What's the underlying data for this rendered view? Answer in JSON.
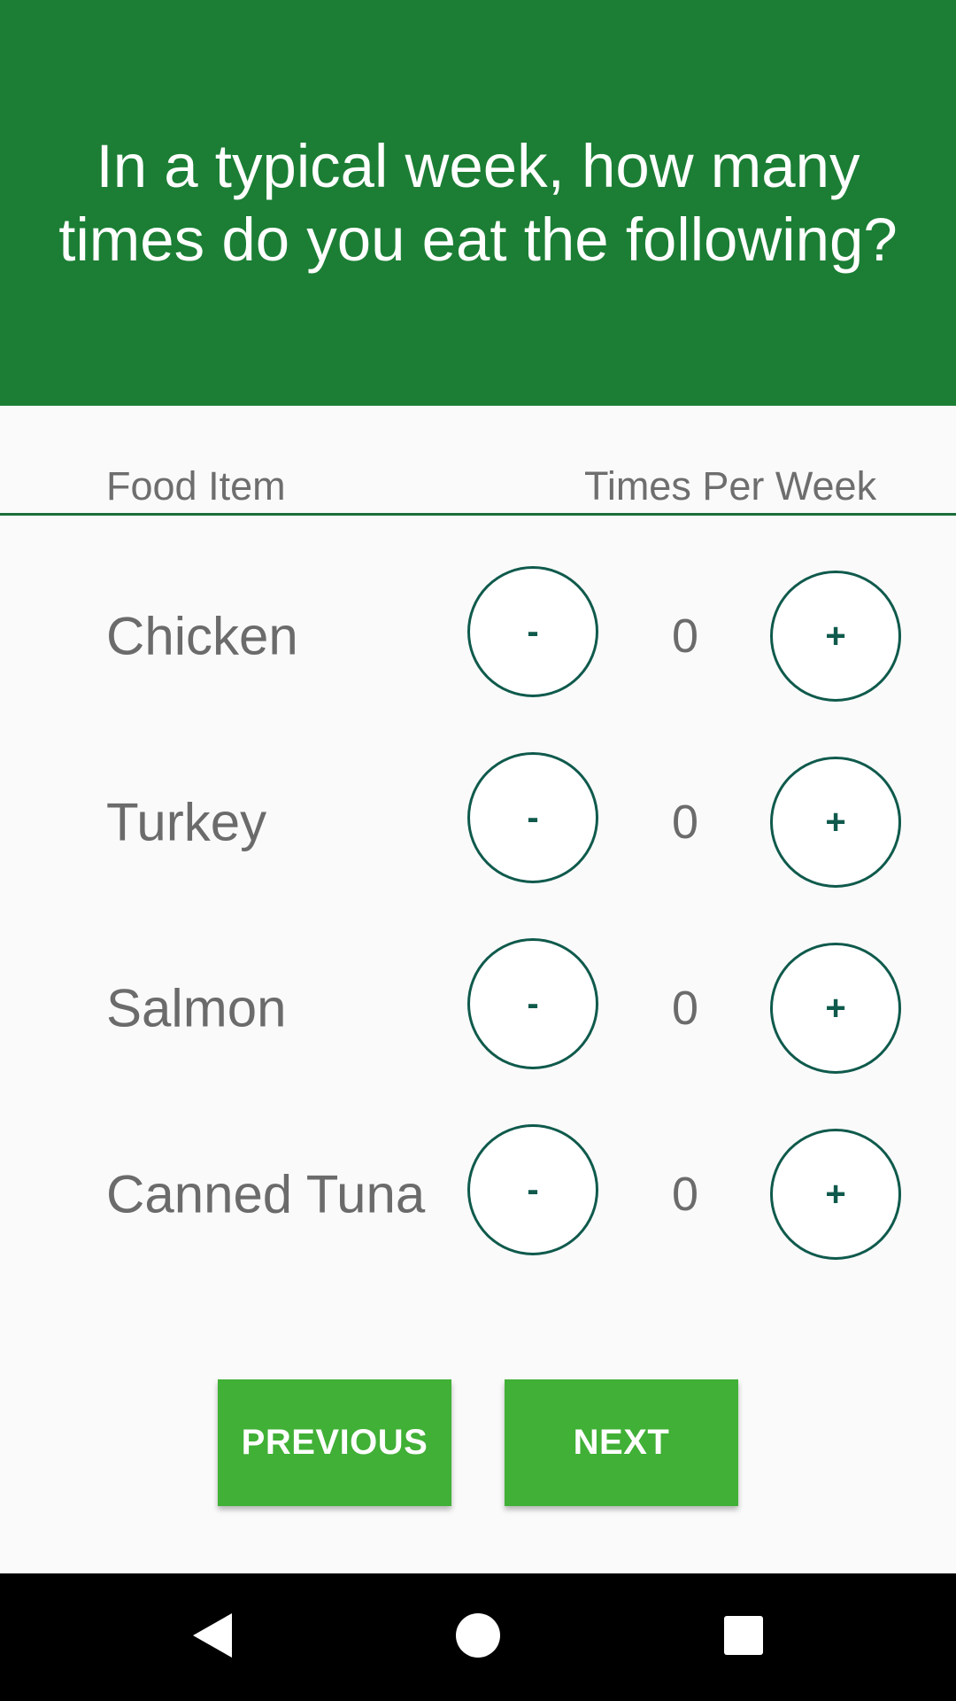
{
  "header": {
    "title": "In a typical week, how many times do you eat the following?"
  },
  "table": {
    "col_food": "Food Item",
    "col_times": "Times Per Week"
  },
  "rows": [
    {
      "name": "Chicken",
      "count": "0",
      "minus": "-",
      "plus": "+"
    },
    {
      "name": "Turkey",
      "count": "0",
      "minus": "-",
      "plus": "+"
    },
    {
      "name": "Salmon",
      "count": "0",
      "minus": "-",
      "plus": "+"
    },
    {
      "name": "Canned Tuna",
      "count": "0",
      "minus": "-",
      "plus": "+"
    }
  ],
  "nav": {
    "previous": "PREVIOUS",
    "next": "NEXT"
  },
  "colors": {
    "header_bg": "#1b7e34",
    "button_green": "#40b036",
    "circle_border": "#0f5a4c"
  },
  "system_nav": {
    "back_icon": "back-triangle-icon",
    "home_icon": "home-circle-icon",
    "recents_icon": "recents-square-icon"
  }
}
